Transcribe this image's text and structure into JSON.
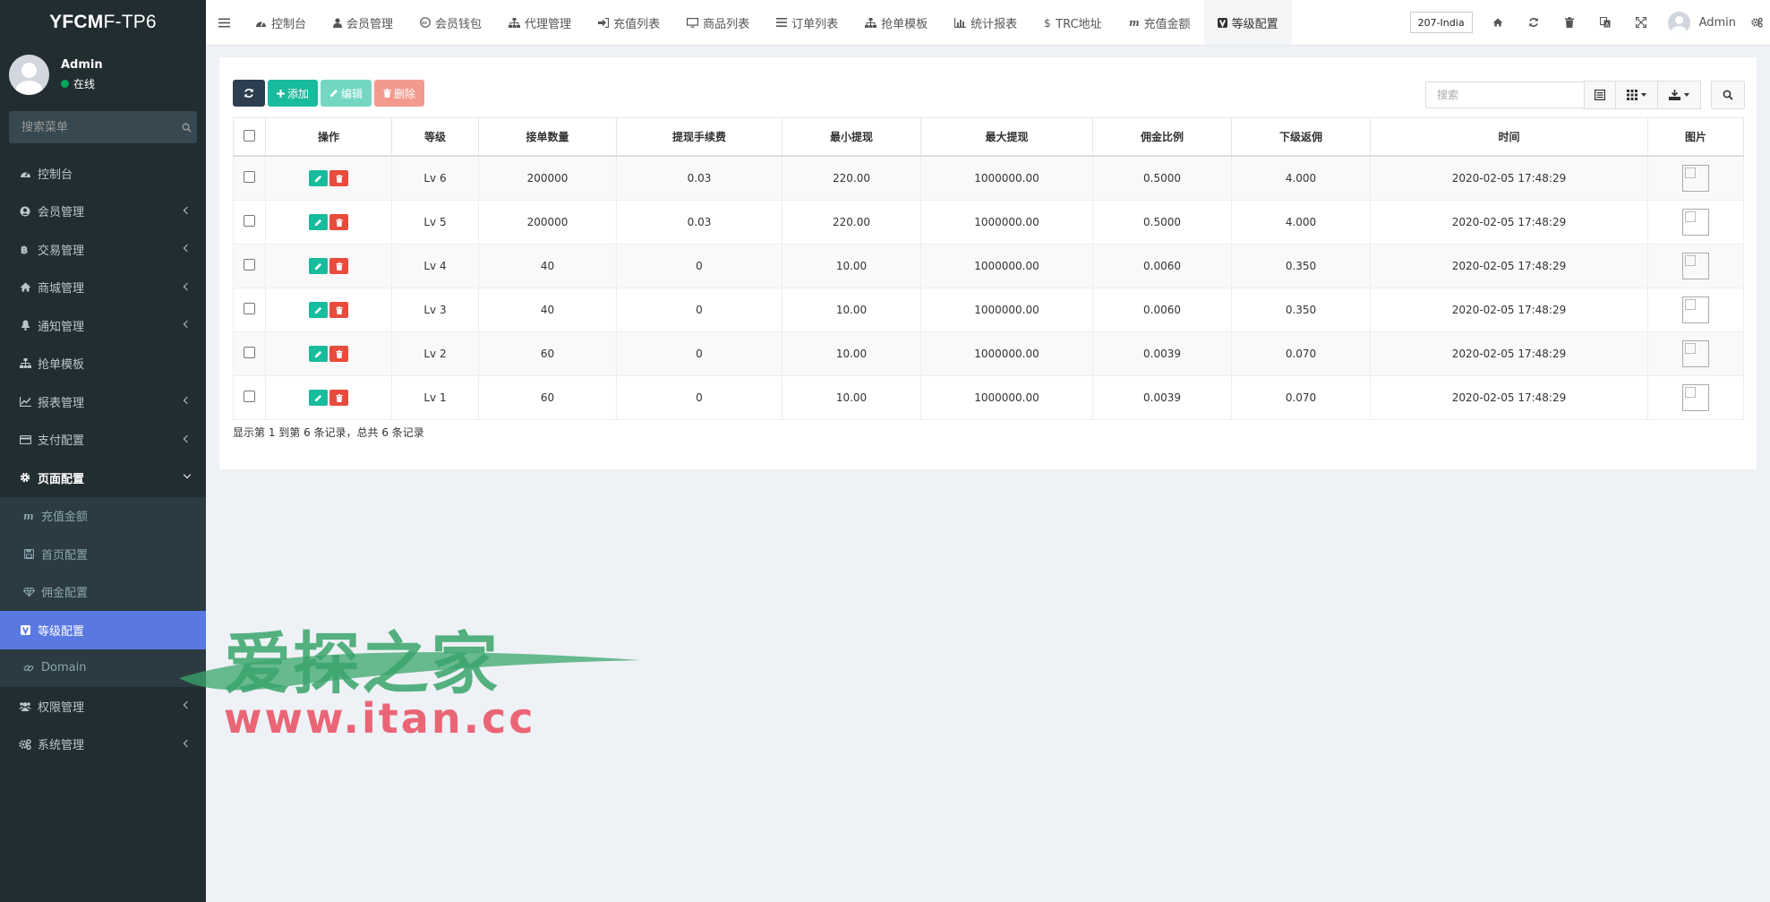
{
  "sidebar": {
    "logo_bold": "YFCM",
    "logo_rest": "F-TP6",
    "user_name": "Admin",
    "user_status": "在线",
    "search_placeholder": "搜索菜单",
    "items": [
      {
        "label": "控制台",
        "icon": "dashboard-icon"
      },
      {
        "label": "会员管理",
        "icon": "user-circle-icon"
      },
      {
        "label": "交易管理",
        "icon": "bitcoin-icon"
      },
      {
        "label": "商城管理",
        "icon": "home-icon"
      },
      {
        "label": "通知管理",
        "icon": "bell-icon"
      },
      {
        "label": "抢单模板",
        "icon": "sitemap-icon"
      },
      {
        "label": "报表管理",
        "icon": "line-chart-icon"
      },
      {
        "label": "支付配置",
        "icon": "credit-card-icon"
      },
      {
        "label": "页面配置",
        "icon": "gear-icon"
      },
      {
        "label": "充值金额",
        "icon": "m-icon"
      },
      {
        "label": "首页配置",
        "icon": "save-icon"
      },
      {
        "label": "佣金配置",
        "icon": "diamond-icon"
      },
      {
        "label": "等级配置",
        "icon": "v-icon"
      },
      {
        "label": "Domain",
        "icon": "link-icon"
      },
      {
        "label": "权限管理",
        "icon": "users-icon"
      },
      {
        "label": "系统管理",
        "icon": "cogs-icon"
      }
    ]
  },
  "topbar": {
    "tabs": [
      {
        "label": "控制台",
        "icon": "dashboard-icon"
      },
      {
        "label": "会员管理",
        "icon": "user-icon"
      },
      {
        "label": "会员钱包",
        "icon": "cc-icon"
      },
      {
        "label": "代理管理",
        "icon": "sitemap-icon"
      },
      {
        "label": "充值列表",
        "icon": "sign-in-icon"
      },
      {
        "label": "商品列表",
        "icon": "desktop-icon"
      },
      {
        "label": "订单列表",
        "icon": "list-icon"
      },
      {
        "label": "抢单模板",
        "icon": "sitemap-icon"
      },
      {
        "label": "统计报表",
        "icon": "bar-chart-icon"
      },
      {
        "label": "TRC地址",
        "icon": "dollar-icon"
      },
      {
        "label": "充值金额",
        "icon": "m-icon"
      },
      {
        "label": "等级配置",
        "icon": "v-icon"
      }
    ],
    "lang_value": "207-India",
    "admin_name": "Admin"
  },
  "toolbar": {
    "add_label": "添加",
    "edit_label": "编辑",
    "delete_label": "删除",
    "search_placeholder": "搜索"
  },
  "table": {
    "headers": [
      "操作",
      "等级",
      "接单数量",
      "提现手续费",
      "最小提现",
      "最大提现",
      "佣金比例",
      "下级返佣",
      "时间",
      "图片"
    ],
    "rows": [
      {
        "level": "Lv 6",
        "orders": "200000",
        "fee": "0.03",
        "min": "220.00",
        "max": "1000000.00",
        "ratio": "0.5000",
        "rebate": "4.000",
        "time": "2020-02-05 17:48:29"
      },
      {
        "level": "Lv 5",
        "orders": "200000",
        "fee": "0.03",
        "min": "220.00",
        "max": "1000000.00",
        "ratio": "0.5000",
        "rebate": "4.000",
        "time": "2020-02-05 17:48:29"
      },
      {
        "level": "Lv 4",
        "orders": "40",
        "fee": "0",
        "min": "10.00",
        "max": "1000000.00",
        "ratio": "0.0060",
        "rebate": "0.350",
        "time": "2020-02-05 17:48:29"
      },
      {
        "level": "Lv 3",
        "orders": "40",
        "fee": "0",
        "min": "10.00",
        "max": "1000000.00",
        "ratio": "0.0060",
        "rebate": "0.350",
        "time": "2020-02-05 17:48:29"
      },
      {
        "level": "Lv 2",
        "orders": "60",
        "fee": "0",
        "min": "10.00",
        "max": "1000000.00",
        "ratio": "0.0039",
        "rebate": "0.070",
        "time": "2020-02-05 17:48:29"
      },
      {
        "level": "Lv 1",
        "orders": "60",
        "fee": "0",
        "min": "10.00",
        "max": "1000000.00",
        "ratio": "0.0039",
        "rebate": "0.070",
        "time": "2020-02-05 17:48:29"
      }
    ]
  },
  "pagination": {
    "summary": "显示第 1 到第 6 条记录，总共 6 条记录"
  },
  "watermark": {
    "title": "爱探之家",
    "url": "www.itan.cc"
  },
  "colors": {
    "sidebar_bg": "#222d32",
    "active_item": "#5a78e1",
    "add_green": "#18bc9c",
    "delete_red": "#e74c3c",
    "dark_button": "#2c3e50"
  }
}
